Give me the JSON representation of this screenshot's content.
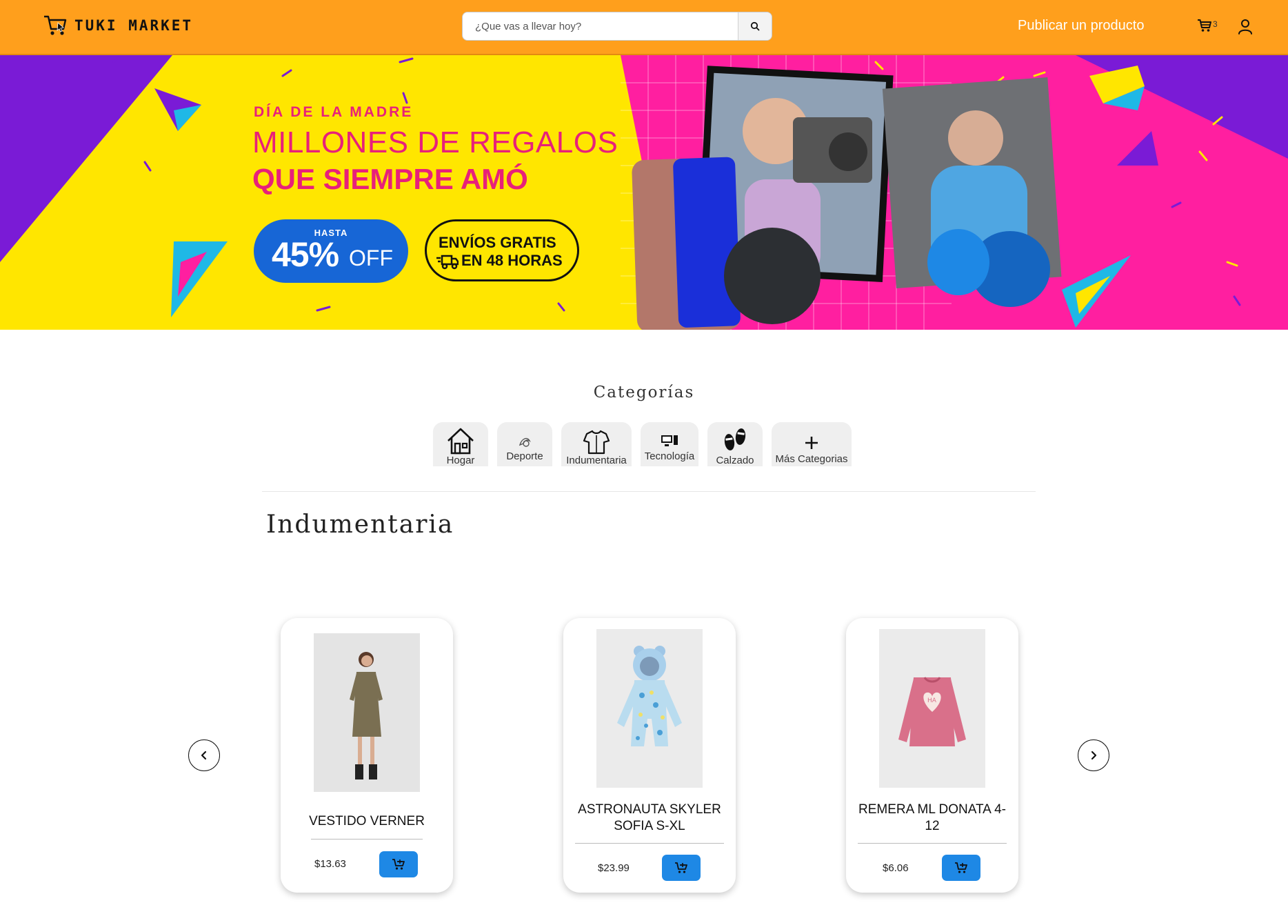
{
  "header": {
    "brand": "TUKI MARKET",
    "search_placeholder": "¿Que vas a llevar hoy?",
    "publish_label": "Publicar un producto",
    "cart_count": "3"
  },
  "banner": {
    "subtitle": "DÍA DE LA MADRE",
    "title_line1": "MILLONES DE REGALOS",
    "title_line2": "QUE SIEMPRE AMÓ",
    "discount_prefix": "HASTA",
    "discount_value": "45%",
    "discount_suffix": "OFF",
    "shipping_line1": "ENVÍOS GRATIS",
    "shipping_line2": "EN 48 HORAS",
    "colors": {
      "yellow": "#FFE600",
      "magenta": "#FF1FA0",
      "purple": "#7A1BD6",
      "blue": "#1766D6"
    }
  },
  "categories": {
    "title": "Categorías",
    "items": [
      {
        "label": "Hogar",
        "icon": "house-icon"
      },
      {
        "label": "Deporte",
        "icon": "sport-icon"
      },
      {
        "label": "Indumentaria",
        "icon": "shirt-icon"
      },
      {
        "label": "Tecnología",
        "icon": "computer-icon"
      },
      {
        "label": "Calzado",
        "icon": "footprints-icon"
      },
      {
        "label": "Más Categorias",
        "icon": "plus-icon"
      }
    ]
  },
  "section": {
    "title": "Indumentaria",
    "products": [
      {
        "name": "VESTIDO VERNER",
        "price": "$13.63",
        "image": "woman-dress-photo"
      },
      {
        "name": "ASTRONAUTA SKYLER SOFIA S-XL",
        "price": "$23.99",
        "image": "baby-snowsuit-photo"
      },
      {
        "name": "REMERA ML DONATA 4-12",
        "price": "$6.06",
        "image": "pink-sweatshirt-photo"
      }
    ]
  },
  "theme": {
    "header_color": "#FF9F1C",
    "button_color": "#1E88E5"
  }
}
